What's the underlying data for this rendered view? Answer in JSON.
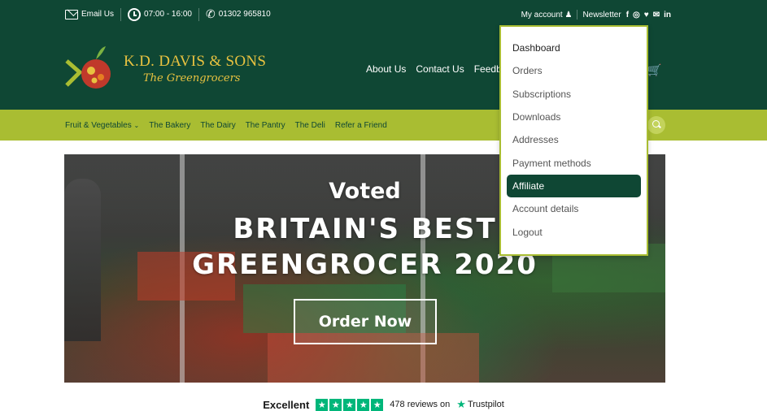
{
  "topbar": {
    "email_label": "Email Us",
    "hours": "07:00 - 16:00",
    "phone": "01302 965810",
    "my_account": "My account",
    "newsletter": "Newsletter",
    "social": [
      "f",
      "◎",
      "♥",
      "✉",
      "in"
    ]
  },
  "brand": {
    "name": "K.D. DAVIS & SONS",
    "tagline": "The Greengrocers"
  },
  "mainnav": [
    "About Us",
    "Contact Us",
    "Feedback"
  ],
  "catnav": [
    "Fruit & Vegetables",
    "The Bakery",
    "The Dairy",
    "The Pantry",
    "The Deli",
    "Refer a Friend"
  ],
  "hero": {
    "line1": "Voted",
    "line2": "BRITAIN'S BEST",
    "line3": "GREENGROCER 2020",
    "button": "Order Now"
  },
  "trustpilot": {
    "rating_word": "Excellent",
    "reviews": "478 reviews on",
    "brand": "Trustpilot"
  },
  "account_menu": {
    "items": [
      "Dashboard",
      "Orders",
      "Subscriptions",
      "Downloads",
      "Addresses",
      "Payment methods",
      "Affiliate",
      "Account details",
      "Logout"
    ],
    "active_index": 6
  },
  "colors": {
    "brand_green": "#0f4734",
    "lime": "#a9bd32",
    "gold": "#e8c240",
    "trust_green": "#00b67a"
  }
}
